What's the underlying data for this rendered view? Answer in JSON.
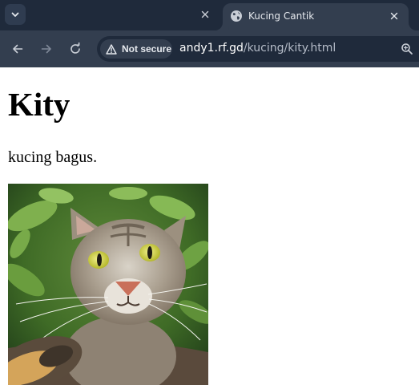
{
  "browser": {
    "tab": {
      "title": "Kucing Cantik"
    },
    "address_bar": {
      "security_label": "Not secure",
      "url_host": "andy1.rf.gd",
      "url_path": "/kucing/kity.html"
    },
    "colors": {
      "tabstrip": "#1f2a3b",
      "toolbar": "#333e4f",
      "icon": "#c9ced6"
    }
  },
  "page": {
    "heading": "Kity",
    "paragraph": "kucing bagus.",
    "image": {
      "subject": "cat selfie with green leaves background"
    }
  },
  "icons": {
    "tab_menu": "chevron-down-icon",
    "close": "close-icon",
    "favicon": "globe-icon",
    "back": "arrow-left-icon",
    "forward": "arrow-right-icon",
    "reload": "reload-icon",
    "warning": "warning-triangle-icon",
    "zoom": "zoom-icon"
  }
}
